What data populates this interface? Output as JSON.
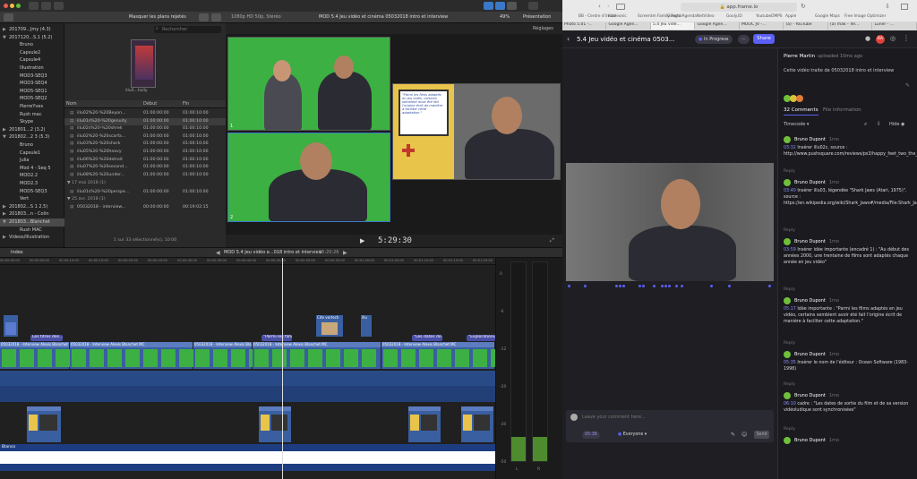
{
  "fcp": {
    "toolbar": {
      "filter_label": "Masquer les plans rejetés",
      "format_label": "1080p HD 50p, Stéréo",
      "project_title": "MOD 5.4 Jeu vidéo et cinéma 05032018 intro et interview",
      "zoom": "49%",
      "view_label": "Présentation",
      "search_placeholder": "Rechercher",
      "viewer_settings": "Réglages"
    },
    "sidebar": [
      {
        "label": "201709...Jmy (4.3)",
        "level": 0,
        "arrow": "▶"
      },
      {
        "label": "2017120...S.1 (5.2)",
        "level": 0,
        "arrow": "▼"
      },
      {
        "label": "Bruno",
        "level": 1
      },
      {
        "label": "Capsule2",
        "level": 1
      },
      {
        "label": "Capsule4",
        "level": 1
      },
      {
        "label": "Illustration",
        "level": 1
      },
      {
        "label": "MOD3-SEQ3",
        "level": 1
      },
      {
        "label": "MOD3-SEQ4",
        "level": 1
      },
      {
        "label": "MOD5-SEQ1",
        "level": 1
      },
      {
        "label": "MOD5-SEQ2",
        "level": 1
      },
      {
        "label": "PierreYves",
        "level": 1
      },
      {
        "label": "Rush mac",
        "level": 1
      },
      {
        "label": "Skype",
        "level": 1
      },
      {
        "label": "201801...2 (3.2)",
        "level": 0,
        "arrow": "▶"
      },
      {
        "label": "201802...2 3 (5.3)",
        "level": 0,
        "arrow": "▼"
      },
      {
        "label": "Bruno",
        "level": 1
      },
      {
        "label": "Capsule1",
        "level": 1
      },
      {
        "label": "Julia",
        "level": 1
      },
      {
        "label": "Mod 4 - Seq 5",
        "level": 1
      },
      {
        "label": "MOD2.2",
        "level": 1
      },
      {
        "label": "MOD2.3",
        "level": 1
      },
      {
        "label": "MOD5-SEQ3",
        "level": 1
      },
      {
        "label": "Vert",
        "level": 1
      },
      {
        "label": "201802...S 1 2.5)",
        "level": 0,
        "arrow": "▶"
      },
      {
        "label": "201803...n - Colin",
        "level": 0,
        "arrow": "▶"
      },
      {
        "label": "201803...Blanchet",
        "level": 0,
        "arrow": "▼",
        "selected": true
      },
      {
        "label": "Rush MAC",
        "level": 1
      },
      {
        "label": "Videos/Illustration",
        "level": 0,
        "arrow": "▶"
      }
    ],
    "browser": {
      "thumb_label": "illu0...holly",
      "columns": [
        "Nom",
        "Début",
        "Fin"
      ],
      "rows": [
        {
          "name": "illu02%20-%20Beyon...",
          "start": "01:00:00:00",
          "end": "01:00:10:00"
        },
        {
          "name": "illu01s%20-%20genuity",
          "start": "01:00:00:00",
          "end": "01:00:10:00",
          "selected": true
        },
        {
          "name": "illu02s%20-%20shrek",
          "start": "01:00:00:00",
          "end": "01:00:10:00"
        },
        {
          "name": "illu02%20-%20scarfa...",
          "start": "01:00:00:00",
          "end": "01:00:10:00"
        },
        {
          "name": "illu03%20-%20shark",
          "start": "01:00:00:00",
          "end": "01:00:10:00"
        },
        {
          "name": "illu05%20-%20heavy",
          "start": "01:00:00:00",
          "end": "01:00:10:00"
        },
        {
          "name": "illu06%20-%20detroit",
          "start": "01:00:00:00",
          "end": "01:00:10:00"
        },
        {
          "name": "illu07%20-%20second...",
          "start": "01:00:00:00",
          "end": "01:00:10:00"
        },
        {
          "name": "illu08%20-%20under...",
          "start": "01:00:00:00",
          "end": "01:00:10:00"
        }
      ],
      "group1": "17 mai 2018  (1)",
      "group1_row": {
        "name": "illu01s%20-%20perspe...",
        "start": "01:00:00:00",
        "end": "01:00:10:00"
      },
      "group2": "25 avr. 2018  (1)",
      "group2_row": {
        "name": "05032018 - interview...",
        "start": "00:00:00:00",
        "end": "00:19:02:15"
      },
      "footer": "1 sur 33 sélectionné(s), 10:00"
    },
    "viewer": {
      "panel_labels": [
        "1",
        "2"
      ],
      "illustration_text": "\"Parmi les films adaptés en jeu vidéo, certains semblent avoir été fait l'origine écrit de manière à faciliter cette adaptation.\"",
      "timecode": "5:29:30"
    },
    "timeline_bar": {
      "index_label": "Index",
      "project": "MOD 5.4 Jeu vidéo e...018 intro et interview",
      "duration": "15:20:26"
    },
    "ruler_ticks": [
      "00:00:00:00",
      "00:00:05:00",
      "00:00:10:00",
      "00:00:15:00",
      "00:00:20:00",
      "00:00:25:00",
      "00:00:30:00",
      "00:00:35:00",
      "00:00:40:00",
      "00:00:45:00",
      "00:00:50:00",
      "00:00:55:00",
      "00:01:00:00",
      "00:01:05:00",
      "00:01:10:00",
      "00:01:15:00",
      "00:01:20:00"
    ],
    "title_clips": [
      {
        "label": "Les titres des..."
      },
      {
        "label": "\"Parmi les films...\""
      },
      {
        "label": "\"Les dates de...\""
      },
      {
        "label": "\"Explorations...\""
      }
    ],
    "connected_clips": [
      {
        "label": "Cite vortech"
      },
      {
        "label": "illu"
      }
    ],
    "main_clip_label": "05032018 - Interview Alexis Blanchet MC",
    "bottom_label": "Blanco",
    "meter_labels": [
      "0",
      "-6",
      "-12",
      "-20",
      "-30",
      "-50"
    ],
    "meter_channels": [
      "L",
      "R"
    ],
    "meter_level": 0.12
  },
  "safari": {
    "url": "app.frame.io",
    "favorites": [
      "BB - Centre d'invite",
      "Kaaleonic",
      "Screentm Family Portal",
      "Google Agenda",
      "NetVideo",
      "Gooly.ID",
      "YoutubeDMPS",
      "Apple",
      "Google Maps",
      "Free Image Optimizer"
    ],
    "tabs": [
      {
        "label": "Photo 5.01 -..."
      },
      {
        "label": "Google Agen..."
      },
      {
        "label": "5.4 Jeu vidé...",
        "active": true
      },
      {
        "label": "Google Agen..."
      },
      {
        "label": "MOOC JV -..."
      },
      {
        "label": "(a) - YouTube"
      },
      {
        "label": "(a) mak - Tél..."
      },
      {
        "label": "Luner - ..."
      }
    ]
  },
  "frameio": {
    "title": "5.4 Jeu vidéo et cinéma 0503...",
    "status": "In Progress",
    "more": "···",
    "share": "Share",
    "avatars": [
      {
        "initials": "BA",
        "color": "#e0433b"
      }
    ],
    "uploader": "Pierre Martin",
    "uploaded": "uploaded 10mo ago",
    "description": "Cette vidéo traite de 05032018 intro et interview",
    "tabs": [
      "32 Comments",
      "File Information"
    ],
    "sort": "Timecode",
    "hide": "Hide",
    "comments": [
      {
        "author": "Bruno Dupont",
        "ago": "1mo",
        "time": "03:32",
        "text": "Insérer illu02c, source : http://www.pushsquare.com/reviews/ps3/happy_feet_two_the_video_game"
      },
      {
        "author": "Bruno Dupont",
        "ago": "1mo",
        "time": "03:40",
        "text": "Insérer illu03, légendée \"Shark Jaws (Atari, 1975)\", source : https://en.wikipedia.org/wiki/Shark_Jaws#/media/File:Shark_Jaws_1975_Video_Game_Flyer.jpg"
      },
      {
        "author": "Bruno Dupont",
        "ago": "1mo",
        "time": "03:59",
        "text": "Insérer idée importante (encadré 1) : \"Au début des années 2000, une trentaine de films sont adaptés chaque année en jeu vidéo\""
      },
      {
        "author": "Bruno Dupont",
        "ago": "1mo",
        "time": "05:17",
        "text": "Idée importante : \"Parmi les films adaptés en jeu vidéo, certains semblent avoir été fait l'origine écrit de manière à faciliter cette adaptation.\""
      },
      {
        "author": "Bruno Dupont",
        "ago": "1mo",
        "time": "05:35",
        "text": "Insérer le nom de l'éditeur : Ocean Software (1983-1998)"
      },
      {
        "author": "Bruno Dupont",
        "ago": "1mo",
        "time": "06:10",
        "text": "cadre : \"Les dates de sortie du film et de sa version vidéoludique sont synchronisées\""
      },
      {
        "author": "Bruno Dupont",
        "ago": "1mo",
        "time": "",
        "text": ""
      }
    ],
    "reply_label": "Reply",
    "comment_placeholder": "Leave your comment here...",
    "comment_time": "05:36",
    "audience": "Everyone",
    "send": "Send"
  }
}
